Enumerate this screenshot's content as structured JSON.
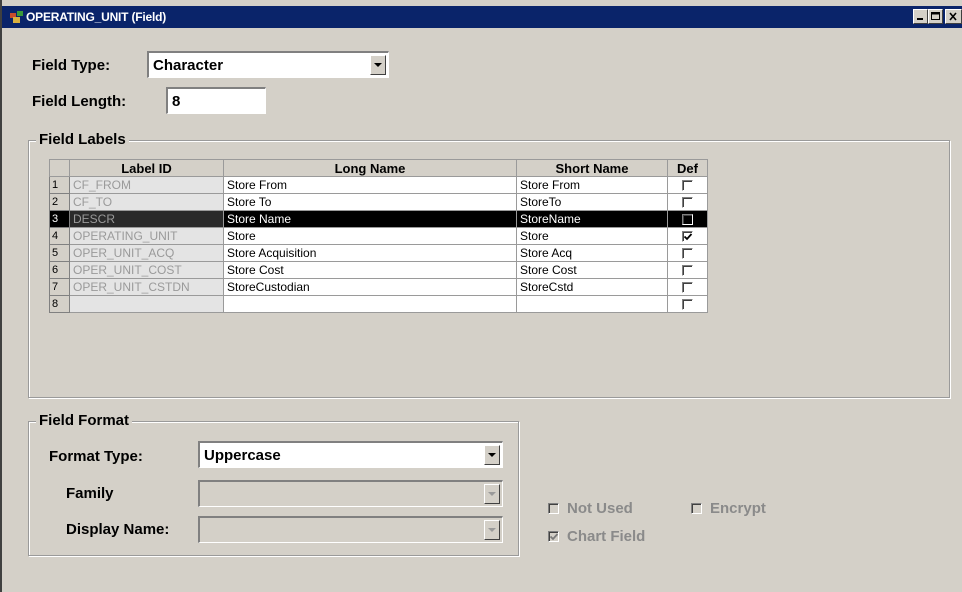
{
  "window": {
    "title": "OPERATING_UNIT (Field)"
  },
  "field_type": {
    "label": "Field Type:",
    "value": "Character"
  },
  "field_length": {
    "label": "Field Length:",
    "value": "8"
  },
  "field_labels": {
    "title": "Field Labels",
    "columns": [
      "Label ID",
      "Long Name",
      "Short Name",
      "Def"
    ],
    "rows": [
      {
        "num": "1",
        "label_id": "CF_FROM",
        "long_name": "Store From",
        "short_name": "Store From",
        "def": false,
        "selected": false
      },
      {
        "num": "2",
        "label_id": "CF_TO",
        "long_name": "Store To",
        "short_name": "StoreTo",
        "def": false,
        "selected": false
      },
      {
        "num": "3",
        "label_id": "DESCR",
        "long_name": "Store Name",
        "short_name": "StoreName",
        "def": false,
        "selected": true
      },
      {
        "num": "4",
        "label_id": "OPERATING_UNIT",
        "long_name": "Store",
        "short_name": "Store",
        "def": true,
        "selected": false
      },
      {
        "num": "5",
        "label_id": "OPER_UNIT_ACQ",
        "long_name": "Store Acquisition",
        "short_name": "Store Acq",
        "def": false,
        "selected": false
      },
      {
        "num": "6",
        "label_id": "OPER_UNIT_COST",
        "long_name": "Store Cost",
        "short_name": "Store Cost",
        "def": false,
        "selected": false
      },
      {
        "num": "7",
        "label_id": "OPER_UNIT_CSTDN",
        "long_name": "StoreCustodian",
        "short_name": "StoreCstd",
        "def": false,
        "selected": false
      },
      {
        "num": "8",
        "label_id": "",
        "long_name": "",
        "short_name": "",
        "def": false,
        "selected": false
      }
    ]
  },
  "field_format": {
    "title": "Field Format",
    "format_type": {
      "label": "Format Type:",
      "value": "Uppercase"
    },
    "family": {
      "label": "Family",
      "value": ""
    },
    "display_name": {
      "label": "Display Name:",
      "value": ""
    }
  },
  "options": {
    "not_used": {
      "label": "Not Used",
      "checked": false
    },
    "encrypt": {
      "label": "Encrypt",
      "checked": false
    },
    "chart_field": {
      "label": "Chart Field",
      "checked": true
    }
  },
  "colors": {
    "titlebar": "#0a246a",
    "face": "#d4d0c8",
    "selection": "#000000"
  }
}
